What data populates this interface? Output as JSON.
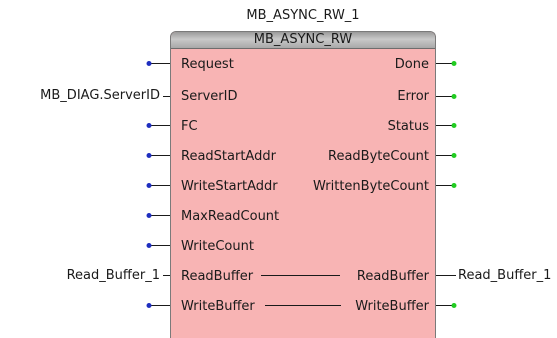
{
  "block": {
    "instance_name": "MB_ASYNC_RW_1",
    "type_name": "MB_ASYNC_RW"
  },
  "inputs": [
    {
      "label": "Request",
      "external": ""
    },
    {
      "label": "ServerID",
      "external": "MB_DIAG.ServerID"
    },
    {
      "label": "FC",
      "external": ""
    },
    {
      "label": "ReadStartAddr",
      "external": ""
    },
    {
      "label": "WriteStartAddr",
      "external": ""
    },
    {
      "label": "MaxReadCount",
      "external": ""
    },
    {
      "label": "WriteCount",
      "external": ""
    },
    {
      "label": "ReadBuffer",
      "external": "Read_Buffer_1"
    },
    {
      "label": "WriteBuffer",
      "external": ""
    }
  ],
  "outputs": [
    {
      "label": "Done",
      "external": ""
    },
    {
      "label": "Error",
      "external": ""
    },
    {
      "label": "Status",
      "external": ""
    },
    {
      "label": "ReadByteCount",
      "external": ""
    },
    {
      "label": "WrittenByteCount",
      "external": ""
    },
    {
      "label": "ReadBuffer",
      "external": "Read_Buffer_1"
    },
    {
      "label": "WriteBuffer",
      "external": ""
    }
  ],
  "colors": {
    "block_fill": "#f8b4b4",
    "input_dot": "#1f2fbf",
    "output_dot": "#22cc22",
    "wire": "#1a1a1a"
  }
}
